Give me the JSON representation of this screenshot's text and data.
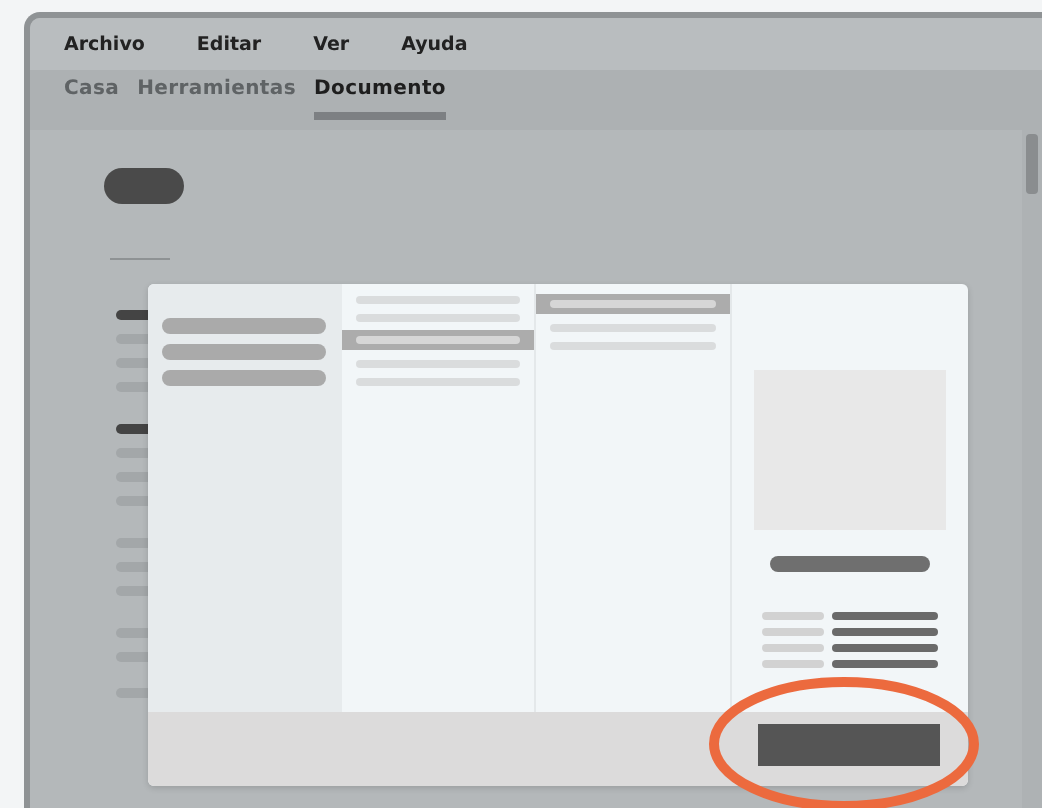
{
  "menu": [
    {
      "label": "Archivo"
    },
    {
      "label": "Editar"
    },
    {
      "label": "Ver"
    },
    {
      "label": "Ayuda"
    }
  ],
  "tabs": [
    {
      "label": "Casa",
      "selected": false
    },
    {
      "label": "Herramientas",
      "selected": false
    },
    {
      "label": "Documento",
      "selected": true
    }
  ],
  "dialog": {
    "columns": [
      {
        "rows": [
          {
            "selected": false
          },
          {
            "selected": false
          },
          {
            "selected": true
          },
          {
            "selected": false
          },
          {
            "selected": false
          }
        ]
      },
      {
        "rows": [
          {
            "selected": true
          },
          {
            "selected": false
          },
          {
            "selected": false
          }
        ]
      }
    ]
  }
}
